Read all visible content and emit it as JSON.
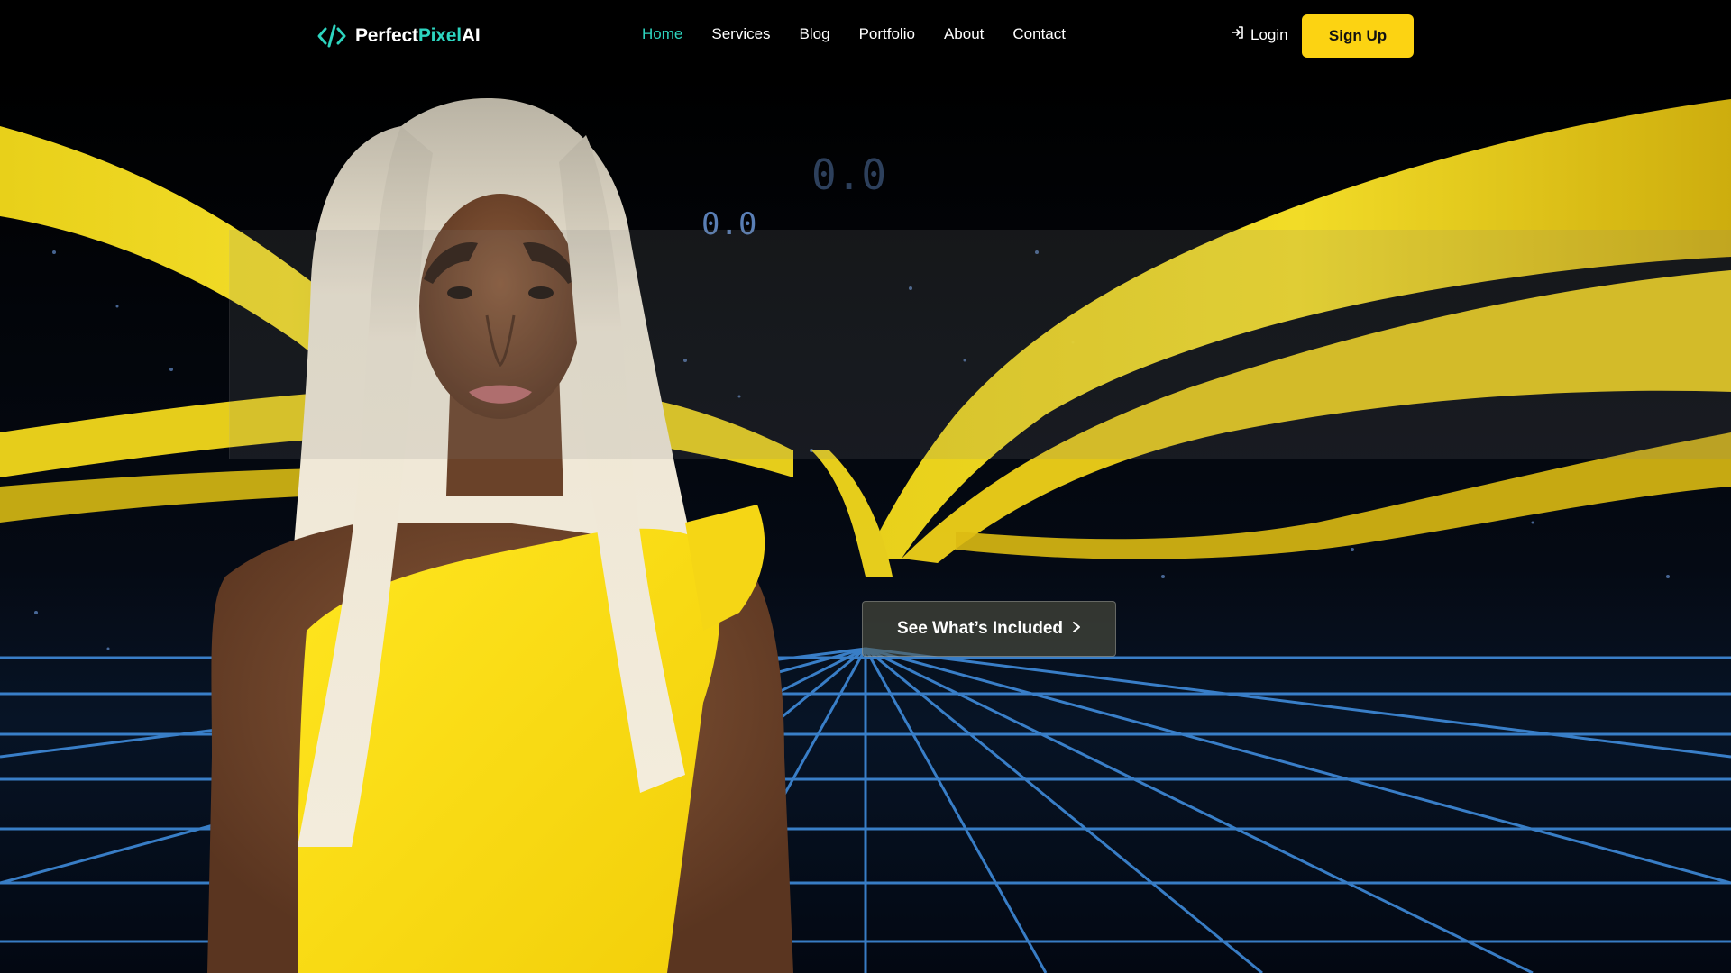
{
  "brand": {
    "name_part1": "Perfect",
    "name_part2": "Pixel",
    "name_part3": "AI",
    "icon": "code-brackets-icon",
    "accent_color": "#2dd4bf"
  },
  "nav": {
    "items": [
      {
        "label": "Home",
        "active": true
      },
      {
        "label": "Services",
        "active": false
      },
      {
        "label": "Blog",
        "active": false
      },
      {
        "label": "Portfolio",
        "active": false
      },
      {
        "label": "About",
        "active": false
      },
      {
        "label": "Contact",
        "active": false
      }
    ],
    "login_label": "Login",
    "login_icon": "login-arrow-icon",
    "signup_label": "Sign Up",
    "signup_color": "#fcd312"
  },
  "hero": {
    "cta_label": "See What’s Included",
    "cta_icon": "chevron-right-icon",
    "image": "model-in-yellow-dress-with-neon-grid-background"
  }
}
